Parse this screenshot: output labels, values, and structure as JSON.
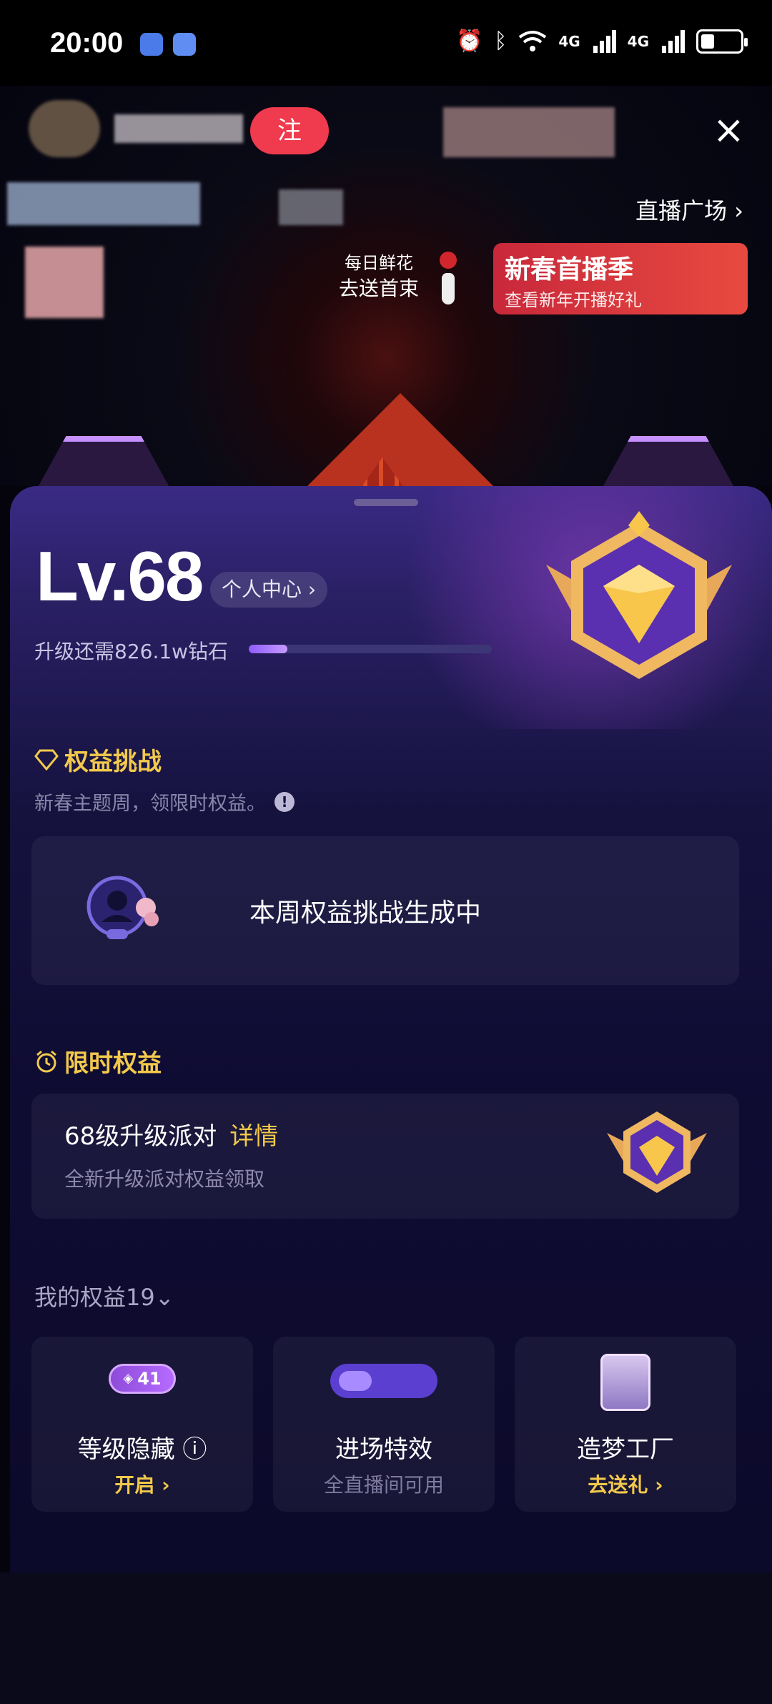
{
  "status_bar": {
    "time": "20:00",
    "network_1": "4G",
    "network_2": "4G"
  },
  "stream": {
    "follow_label": "注",
    "close_icon": "×",
    "plaza_label": "直播广场 ›",
    "flower_title": "每日鲜花",
    "flower_action": "去送首束",
    "promo_title": "新春首播季",
    "promo_sub": "查看新年开播好礼"
  },
  "level": {
    "label": "Lv.68",
    "personal_center": "个人中心 ›",
    "upgrade_text": "升级还需826.1w钻石",
    "progress_fraction": 0.16
  },
  "challenge": {
    "title": "权益挑战",
    "subtitle": "新春主题周，领限时权益。",
    "info": "!",
    "status": "本周权益挑战生成中"
  },
  "limited": {
    "title": "限时权益",
    "item_title": "68级升级派对",
    "item_link": "详情",
    "item_sub": "全新升级派对权益领取"
  },
  "my_benefits": {
    "title": "我的权益19⌄",
    "items": [
      {
        "name": "等级隐藏 ⓘ",
        "action": "开启 ›",
        "pill": "41"
      },
      {
        "name": "进场特效",
        "note": "全直播间可用"
      },
      {
        "name": "造梦工厂",
        "action": "去送礼 ›"
      }
    ]
  },
  "colors": {
    "accent_gold": "#f2c94c",
    "sheet_top": "#3a2a85",
    "sheet_bottom": "#0c0a2a"
  }
}
